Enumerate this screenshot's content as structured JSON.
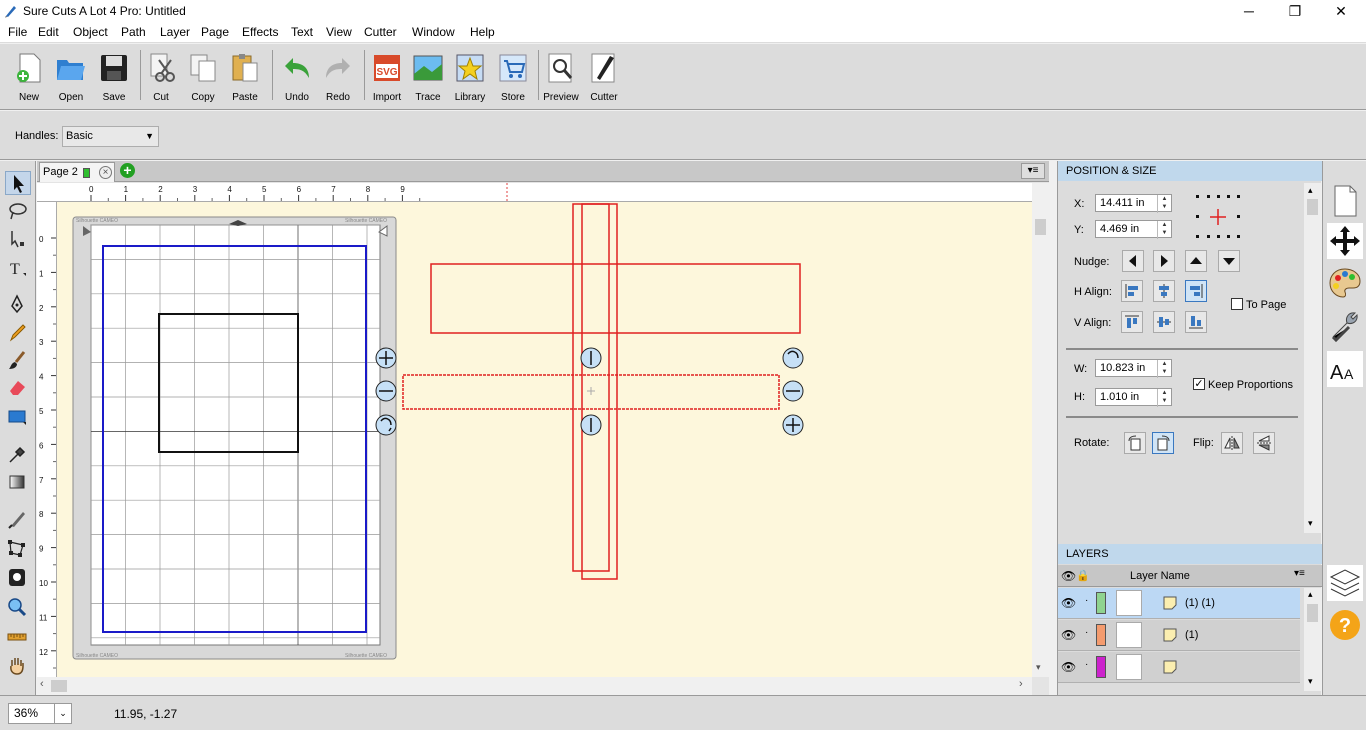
{
  "window": {
    "title": "Sure Cuts A Lot 4 Pro: Untitled",
    "controls": {
      "minimize": "─",
      "maximize": "❐",
      "close": "✕"
    }
  },
  "menu": [
    "File",
    "Edit",
    "Object",
    "Path",
    "Layer",
    "Page",
    "Effects",
    "Text",
    "View",
    "Cutter",
    "Window",
    "Help"
  ],
  "toolbar": {
    "new": "New",
    "open": "Open",
    "save": "Save",
    "cut": "Cut",
    "copy": "Copy",
    "paste": "Paste",
    "undo": "Undo",
    "redo": "Redo",
    "import": "Import",
    "trace": "Trace",
    "library": "Library",
    "store": "Store",
    "preview": "Preview",
    "cutter": "Cutter",
    "svg_badge": "SVG"
  },
  "handles": {
    "label": "Handles:",
    "value": "Basic"
  },
  "page_tab": {
    "label": "Page 2",
    "color": "#2fbf2f"
  },
  "page_menu": "▾≡",
  "ruler": {
    "h_ticks": [
      "0",
      "1",
      "2",
      "3",
      "4",
      "5",
      "6",
      "7",
      "8",
      "9"
    ],
    "v_ticks": [
      "0",
      "1",
      "2",
      "3",
      "4",
      "5",
      "6",
      "7",
      "8",
      "9",
      "10",
      "11",
      "12"
    ]
  },
  "mat": {
    "brand_top_left": "Silhouette CAMEO",
    "brand_top_right": "Silhouette CAMEO",
    "brand_bottom_left": "Silhouette CAMEO",
    "brand_bottom_right": "Silhouette CAMEO"
  },
  "position_size": {
    "header": "POSITION & SIZE",
    "x_label": "X:",
    "x": "14.411 in",
    "y_label": "Y:",
    "y": "4.469 in",
    "nudge_label": "Nudge:",
    "h_align_label": "H Align:",
    "v_align_label": "V Align:",
    "to_page_label": "To Page",
    "to_page_checked": false,
    "w_label": "W:",
    "w": "10.823 in",
    "h_label": "H:",
    "h": "1.010 in",
    "keep_proportions_label": "Keep Proportions",
    "keep_proportions_checked": true,
    "rotate_label": "Rotate:",
    "flip_label": "Flip:"
  },
  "layers": {
    "header": "LAYERS",
    "column": "Layer Name",
    "rows": [
      {
        "name": "(1) (1)",
        "color": "#8fd38f",
        "selected": true
      },
      {
        "name": "(1)",
        "color": "#f49b6e",
        "selected": false
      },
      {
        "name": "",
        "color": "#cc22cc",
        "selected": false
      }
    ]
  },
  "status": {
    "zoom": "36%",
    "coords": "11.95, -1.27"
  },
  "colors": {
    "accent": "#c0d8ec",
    "cut_line": "#e02020",
    "mat_border": "#1a1ac8",
    "canvas": "#fdf7dc"
  }
}
